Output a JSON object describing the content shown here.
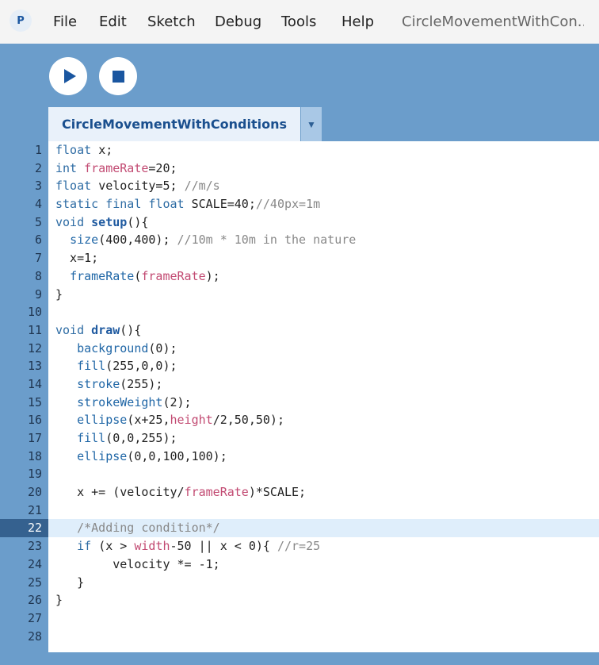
{
  "menu": {
    "items": [
      "File",
      "Edit",
      "Sketch",
      "Debug",
      "Tools",
      "Help"
    ],
    "title": "CircleMovementWithCon..."
  },
  "toolbar": {
    "run_icon": "play-icon",
    "stop_icon": "stop-icon"
  },
  "tabs": [
    {
      "label": "CircleMovementWithConditions"
    }
  ],
  "editor": {
    "highlighted_line": 22,
    "line_numbers": [
      "1",
      "2",
      "3",
      "4",
      "5",
      "6",
      "7",
      "8",
      "9",
      "10",
      "11",
      "12",
      "13",
      "14",
      "15",
      "16",
      "17",
      "18",
      "19",
      "20",
      "21",
      "22",
      "23",
      "24",
      "25",
      "26",
      "27",
      "28"
    ],
    "lines": [
      [
        [
          "kw",
          "float"
        ],
        [
          "",
          "x;"
        ]
      ],
      [
        [
          "kw",
          "int"
        ],
        [
          "",
          ""
        ],
        [
          "pv",
          "frameRate"
        ],
        [
          "",
          "=20;"
        ]
      ],
      [
        [
          "kw",
          "float"
        ],
        [
          "",
          "velocity=5; "
        ],
        [
          "cm",
          "//m/s"
        ]
      ],
      [
        [
          "kw",
          "static final float"
        ],
        [
          "",
          ""
        ],
        [
          "",
          "SCALE=40;"
        ],
        [
          "cm",
          "//40px=1m"
        ]
      ],
      [
        [
          "kw",
          "void"
        ],
        [
          "",
          ""
        ],
        [
          "kb",
          "setup"
        ],
        [
          "",
          ""
        ],
        [
          "",
          "(){"
        ]
      ],
      [
        [
          "",
          "  "
        ],
        [
          "fn",
          "size"
        ],
        [
          "",
          "(400,400); "
        ],
        [
          "cm",
          "//10m * 10m in the nature"
        ]
      ],
      [
        [
          "",
          "  x=1;"
        ]
      ],
      [
        [
          "",
          "  "
        ],
        [
          "fn",
          "frameRate"
        ],
        [
          "",
          "("
        ],
        [
          "pv",
          "frameRate"
        ],
        [
          "",
          ");"
        ]
      ],
      [
        [
          "",
          "}"
        ]
      ],
      [],
      [
        [
          "kw",
          "void"
        ],
        [
          "",
          ""
        ],
        [
          "kb",
          "draw"
        ],
        [
          "",
          "(){"
        ]
      ],
      [
        [
          "",
          "   "
        ],
        [
          "fn",
          "background"
        ],
        [
          "",
          "(0);"
        ]
      ],
      [
        [
          "",
          "   "
        ],
        [
          "fn",
          "fill"
        ],
        [
          "",
          "(255,0,0);"
        ]
      ],
      [
        [
          "",
          "   "
        ],
        [
          "fn",
          "stroke"
        ],
        [
          "",
          "(255);"
        ]
      ],
      [
        [
          "",
          "   "
        ],
        [
          "fn",
          "strokeWeight"
        ],
        [
          "",
          "(2);"
        ]
      ],
      [
        [
          "",
          "   "
        ],
        [
          "fn",
          "ellipse"
        ],
        [
          "",
          "(x+25,"
        ],
        [
          "pv",
          "height"
        ],
        [
          "",
          "/2,50,50);"
        ]
      ],
      [
        [
          "",
          "   "
        ],
        [
          "fn",
          "fill"
        ],
        [
          "",
          "(0,0,255);"
        ]
      ],
      [
        [
          "",
          "   "
        ],
        [
          "fn",
          "ellipse"
        ],
        [
          "",
          "(0,0,100,100);"
        ]
      ],
      [],
      [
        [
          "",
          "   x += (velocity/"
        ],
        [
          "pv",
          "frameRate"
        ],
        [
          "",
          ")*SCALE;"
        ]
      ],
      [],
      [
        [
          "",
          "   "
        ],
        [
          "cm",
          "/*Adding condition*/"
        ]
      ],
      [
        [
          "",
          "   "
        ],
        [
          "kw",
          "if"
        ],
        [
          "",
          "(x > "
        ],
        [
          "pv",
          "width"
        ],
        [
          "",
          "-50 || x < 0){ "
        ],
        [
          "cm",
          "//r=25"
        ]
      ],
      [
        [
          "",
          "        velocity *= -1;"
        ]
      ],
      [
        [
          "",
          "   }"
        ]
      ],
      [
        [
          "",
          "}"
        ]
      ],
      [],
      []
    ]
  }
}
